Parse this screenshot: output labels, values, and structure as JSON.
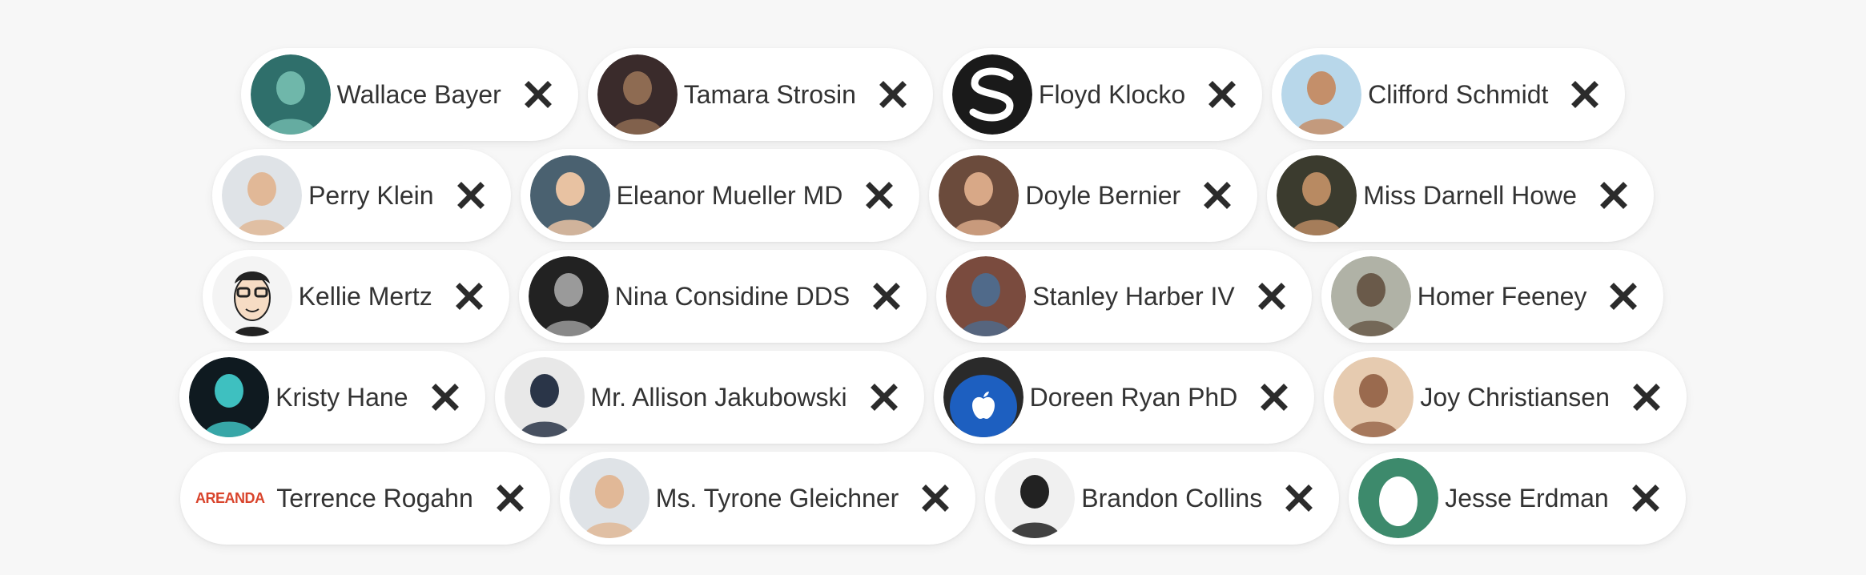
{
  "chips": [
    {
      "name": "Wallace Bayer",
      "avatar": "avatar-photo",
      "avatar_colors": [
        "#2f6f6b",
        "#6fb7aa"
      ]
    },
    {
      "name": "Tamara Strosin",
      "avatar": "avatar-photo",
      "avatar_colors": [
        "#3a2b2b",
        "#8e6b52"
      ]
    },
    {
      "name": "Floyd Klocko",
      "avatar": "s-logo-icon",
      "avatar_colors": [
        "#1a1a1a",
        "#ffffff"
      ]
    },
    {
      "name": "Clifford Schmidt",
      "avatar": "avatar-photo",
      "avatar_colors": [
        "#b8d7ea",
        "#c48f6a"
      ]
    },
    {
      "name": "Perry Klein",
      "avatar": "avatar-photo",
      "avatar_colors": [
        "#dfe3e7",
        "#e1b897"
      ]
    },
    {
      "name": "Eleanor Mueller MD",
      "avatar": "avatar-photo",
      "avatar_colors": [
        "#4a6170",
        "#e8c2a2"
      ]
    },
    {
      "name": "Doyle Bernier",
      "avatar": "avatar-photo",
      "avatar_colors": [
        "#6b4b3c",
        "#d8a887"
      ]
    },
    {
      "name": "Miss Darnell Howe",
      "avatar": "avatar-photo",
      "avatar_colors": [
        "#3b3b2e",
        "#b88a62"
      ]
    },
    {
      "name": "Kellie Mertz",
      "avatar": "avatar-illustration",
      "avatar_colors": [
        "#f4f4f4",
        "#222222"
      ]
    },
    {
      "name": "Nina Considine DDS",
      "avatar": "avatar-photo",
      "avatar_colors": [
        "#222222",
        "#9a9a9a"
      ]
    },
    {
      "name": "Stanley Harber IV",
      "avatar": "avatar-photo",
      "avatar_colors": [
        "#7a4b3e",
        "#506a8a"
      ]
    },
    {
      "name": "Homer Feeney",
      "avatar": "avatar-photo",
      "avatar_colors": [
        "#b0b2a6",
        "#6a5a4a"
      ]
    },
    {
      "name": "Kristy Hane",
      "avatar": "avatar-photo",
      "avatar_colors": [
        "#0f1a20",
        "#3ec0c0"
      ]
    },
    {
      "name": "Mr. Allison Jakubowski",
      "avatar": "avatar-photo",
      "avatar_colors": [
        "#e8e8e8",
        "#2a3548"
      ]
    },
    {
      "name": "Doreen Ryan PhD",
      "avatar": "apple-logo-icon",
      "avatar_colors": [
        "#1d5fc0",
        "#ffffff"
      ]
    },
    {
      "name": "Joy Christiansen",
      "avatar": "avatar-photo",
      "avatar_colors": [
        "#e6cbb0",
        "#9a6a4e"
      ]
    },
    {
      "name": "Terrence Rogahn",
      "avatar": "text-logo",
      "avatar_text": "AREANDA",
      "avatar_colors": [
        "#ffffff",
        "#d9442c"
      ]
    },
    {
      "name": "Ms. Tyrone Gleichner",
      "avatar": "avatar-photo",
      "avatar_colors": [
        "#dfe3e7",
        "#e1b897"
      ]
    },
    {
      "name": "Brandon Collins",
      "avatar": "avatar-photo",
      "avatar_colors": [
        "#f0f0f0",
        "#222222"
      ]
    },
    {
      "name": "Jesse Erdman",
      "avatar": "egg-icon",
      "avatar_colors": [
        "#3d8a6c",
        "#ffffff"
      ]
    }
  ],
  "remove_icon": "close-icon",
  "colors": {
    "background": "#f7f7f7",
    "chip": "#ffffff",
    "text": "#333333",
    "icon": "#2b2b2b"
  }
}
